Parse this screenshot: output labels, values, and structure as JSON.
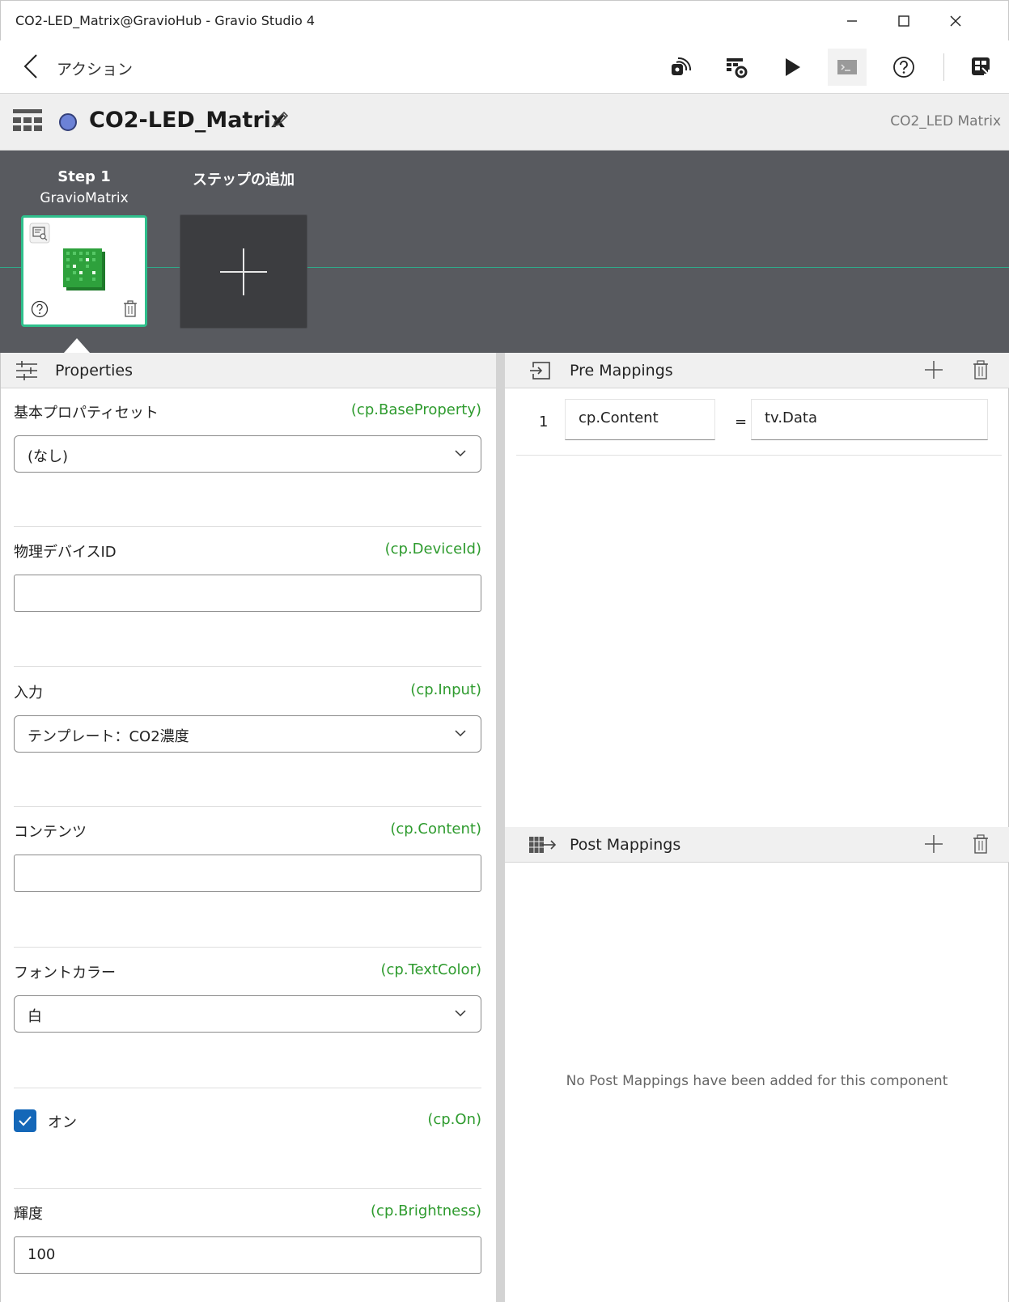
{
  "window": {
    "title": "CO2-LED_Matrix@GravioHub - Gravio Studio 4"
  },
  "toolbar": {
    "section_label": "アクション",
    "icons": [
      "back-icon",
      "remote-icon",
      "settings-table-icon",
      "play-icon",
      "console-icon",
      "help-icon",
      "switch-hub-icon"
    ]
  },
  "header": {
    "action_name": "CO2-LED_Matrix",
    "component_name": "CO2_LED Matrix",
    "status_color": "#6c82d6"
  },
  "steps": {
    "step1_title": "Step 1",
    "step1_component": "GravioMatrix",
    "add_step_label": "ステップの追加",
    "accent_color": "#2fbf8c"
  },
  "properties": {
    "title": "Properties",
    "base_property": {
      "label": "基本プロパティセット",
      "var": "(cp.BaseProperty)",
      "value": "(なし)"
    },
    "device_id": {
      "label": "物理デバイスID",
      "var": "(cp.DeviceId)",
      "value": ""
    },
    "input": {
      "label": "入力",
      "var": "(cp.Input)",
      "value": "テンプレート：CO2濃度"
    },
    "content": {
      "label": "コンテンツ",
      "var": "(cp.Content)",
      "value": ""
    },
    "text_color": {
      "label": "フォントカラー",
      "var": "(cp.TextColor)",
      "value": "白"
    },
    "on": {
      "label": "オン",
      "var": "(cp.On)",
      "checked": true
    },
    "brightness": {
      "label": "輝度",
      "var": "(cp.Brightness)",
      "value": "100"
    }
  },
  "pre_mappings": {
    "title": "Pre Mappings",
    "rows": [
      {
        "index": "1",
        "left": "cp.Content",
        "op": "=",
        "right": "tv.Data"
      }
    ]
  },
  "post_mappings": {
    "title": "Post Mappings",
    "empty_message": "No Post Mappings have been added for this component"
  }
}
